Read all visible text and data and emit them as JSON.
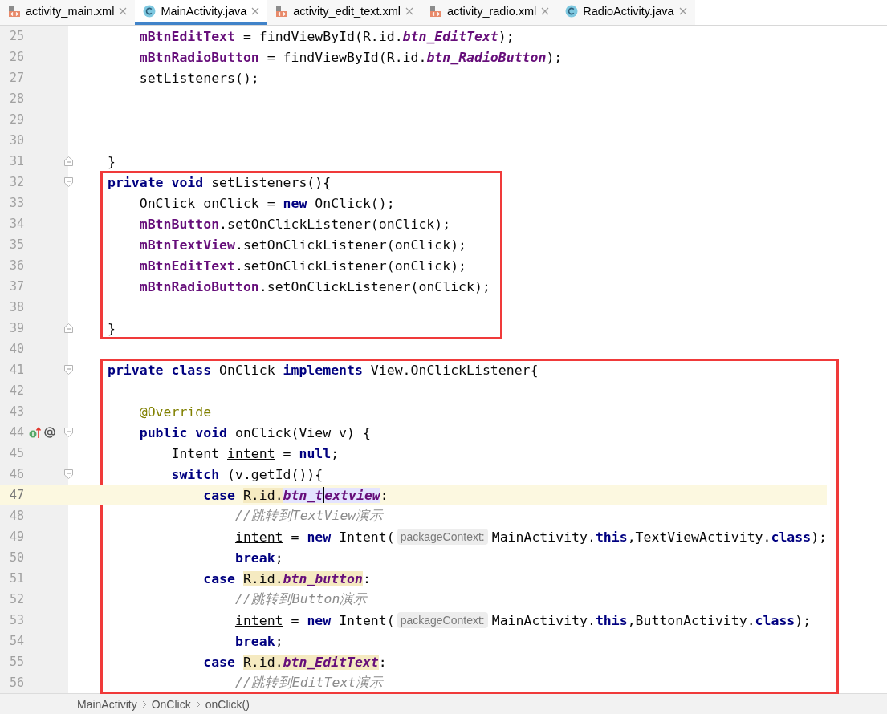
{
  "tabs": [
    {
      "label": "activity_main.xml",
      "kind": "xml",
      "selected": false
    },
    {
      "label": "MainActivity.java",
      "kind": "java",
      "selected": true
    },
    {
      "label": "activity_edit_text.xml",
      "kind": "xml",
      "selected": false
    },
    {
      "label": "activity_radio.xml",
      "kind": "xml",
      "selected": false
    },
    {
      "label": "RadioActivity.java",
      "kind": "java",
      "selected": false
    }
  ],
  "editor": {
    "blocks": [
      {
        "boxed": false,
        "lines": [
          {
            "number": "25",
            "current": false,
            "fold_start": false,
            "fold_end": false,
            "tokens": [
              {
                "kind": "field",
                "text": "    mBtnEditText"
              },
              {
                "kind": "plain",
                "text": " = findViewById(R.id."
              },
              {
                "kind": "static",
                "text": "btn_EditText"
              },
              {
                "kind": "plain",
                "text": ");"
              }
            ]
          },
          {
            "number": "26",
            "current": false,
            "fold_start": false,
            "fold_end": false,
            "tokens": [
              {
                "kind": "field",
                "text": "    mBtnRadioButton"
              },
              {
                "kind": "plain",
                "text": " = findViewById(R.id."
              },
              {
                "kind": "static",
                "text": "btn_RadioButton"
              },
              {
                "kind": "plain",
                "text": ");"
              }
            ]
          },
          {
            "number": "27",
            "current": false,
            "fold_start": false,
            "fold_end": false,
            "tokens": [
              {
                "kind": "plain",
                "text": "    setListeners();"
              }
            ]
          },
          {
            "number": "28",
            "current": false,
            "fold_start": false,
            "fold_end": false
          },
          {
            "number": "29",
            "current": false,
            "fold_start": false,
            "fold_end": false
          },
          {
            "number": "30",
            "current": false,
            "fold_start": false,
            "fold_end": false
          },
          {
            "number": "31",
            "current": false,
            "fold_start": false,
            "fold_end": true,
            "tokens": [
              {
                "kind": "plain",
                "text": "}"
              }
            ]
          }
        ]
      },
      {
        "boxed": true,
        "lines": [
          {
            "number": "32",
            "current": false,
            "fold_start": true,
            "fold_end": false,
            "tokens": [
              {
                "kind": "keyword",
                "text": "private void"
              },
              {
                "kind": "plain",
                "text": " setListeners(){"
              }
            ]
          },
          {
            "number": "33",
            "current": false,
            "fold_start": false,
            "fold_end": false,
            "tokens": [
              {
                "kind": "plain",
                "text": "    OnClick onClick = "
              },
              {
                "kind": "keyword",
                "text": "new"
              },
              {
                "kind": "plain",
                "text": " OnClick();"
              }
            ]
          },
          {
            "number": "34",
            "current": false,
            "fold_start": false,
            "fold_end": false,
            "tokens": [
              {
                "kind": "field",
                "text": "    mBtnButton"
              },
              {
                "kind": "plain",
                "text": ".setOnClickListener(onClick);"
              }
            ]
          },
          {
            "number": "35",
            "current": false,
            "fold_start": false,
            "fold_end": false,
            "tokens": [
              {
                "kind": "field",
                "text": "    mBtnTextView"
              },
              {
                "kind": "plain",
                "text": ".setOnClickListener(onClick);"
              }
            ]
          },
          {
            "number": "36",
            "current": false,
            "fold_start": false,
            "fold_end": false,
            "tokens": [
              {
                "kind": "field",
                "text": "    mBtnEditText"
              },
              {
                "kind": "plain",
                "text": ".setOnClickListener(onClick);"
              }
            ]
          },
          {
            "number": "37",
            "current": false,
            "fold_start": false,
            "fold_end": false,
            "tokens": [
              {
                "kind": "field",
                "text": "    mBtnRadioButton"
              },
              {
                "kind": "plain",
                "text": ".setOnClickListener(onClick);"
              }
            ]
          },
          {
            "number": "38",
            "current": false,
            "fold_start": false,
            "fold_end": false
          },
          {
            "number": "39",
            "current": false,
            "fold_start": false,
            "fold_end": true,
            "tokens": [
              {
                "kind": "plain",
                "text": "}"
              }
            ]
          }
        ]
      },
      {
        "boxed": false,
        "lines": [
          {
            "number": "40",
            "current": false,
            "fold_start": false,
            "fold_end": false
          }
        ]
      },
      {
        "boxed": true,
        "lines": [
          {
            "number": "41",
            "current": false,
            "fold_start": true,
            "fold_end": false,
            "tokens": [
              {
                "kind": "keyword",
                "text": "private class"
              },
              {
                "kind": "plain",
                "text": " OnClick "
              },
              {
                "kind": "keyword",
                "text": "implements"
              },
              {
                "kind": "plain",
                "text": " View.OnClickListener{"
              }
            ]
          },
          {
            "number": "42",
            "current": false,
            "fold_start": false,
            "fold_end": false
          },
          {
            "number": "43",
            "current": false,
            "fold_start": false,
            "fold_end": false,
            "tokens": [
              {
                "kind": "annotation",
                "text": "    @Override"
              }
            ]
          },
          {
            "number": "44",
            "current": false,
            "fold_start": true,
            "fold_end": false,
            "gutter_icons": [
              {
                "kind": "implements"
              },
              {
                "kind": "override"
              }
            ],
            "tokens": [
              {
                "kind": "keyword",
                "text": "    public void"
              },
              {
                "kind": "plain",
                "text": " onClick(View v) {"
              }
            ]
          },
          {
            "number": "45",
            "current": false,
            "fold_start": false,
            "fold_end": false,
            "tokens": [
              {
                "kind": "plain",
                "text": "        Intent "
              },
              {
                "kind": "reassigned",
                "text": "intent"
              },
              {
                "kind": "plain",
                "text": " = "
              },
              {
                "kind": "keyword",
                "text": "null"
              },
              {
                "kind": "plain",
                "text": ";"
              }
            ]
          },
          {
            "number": "46",
            "current": false,
            "fold_start": true,
            "fold_end": false,
            "tokens": [
              {
                "kind": "keyword",
                "text": "        switch"
              },
              {
                "kind": "plain",
                "text": " (v.getId()){"
              }
            ]
          },
          {
            "number": "47",
            "current": true,
            "fold_start": false,
            "fold_end": false,
            "tokens": [
              {
                "kind": "keyword",
                "text": "            case"
              },
              {
                "kind": "ref-usage",
                "text": " R.id."
              },
              {
                "kind": "static-selected",
                "text": "btn_t"
              },
              {
                "kind": "caret"
              },
              {
                "kind": "static-selected",
                "text": "extview"
              },
              {
                "kind": "plain",
                "text": ":"
              }
            ]
          },
          {
            "number": "48",
            "current": false,
            "fold_start": false,
            "fold_end": false,
            "tokens": [
              {
                "kind": "comment",
                "text": "                //跳转到TextView演示"
              }
            ]
          },
          {
            "number": "49",
            "current": false,
            "fold_start": false,
            "fold_end": false,
            "tokens": [
              {
                "kind": "reassigned",
                "text": "                intent"
              },
              {
                "kind": "plain",
                "text": " = "
              },
              {
                "kind": "keyword",
                "text": "new"
              },
              {
                "kind": "plain",
                "text": " Intent("
              },
              {
                "kind": "hint",
                "text": "packageContext:"
              },
              {
                "kind": "plain",
                "text": "MainActivity."
              },
              {
                "kind": "keyword",
                "text": "this"
              },
              {
                "kind": "plain",
                "text": ",TextViewActivity."
              },
              {
                "kind": "keyword",
                "text": "class"
              },
              {
                "kind": "plain",
                "text": ");"
              }
            ]
          },
          {
            "number": "50",
            "current": false,
            "fold_start": false,
            "fold_end": false,
            "tokens": [
              {
                "kind": "keyword",
                "text": "                break"
              },
              {
                "kind": "plain",
                "text": ";"
              }
            ]
          },
          {
            "number": "51",
            "current": false,
            "fold_start": false,
            "fold_end": false,
            "tokens": [
              {
                "kind": "keyword",
                "text": "            case"
              },
              {
                "kind": "ref-usage",
                "text": " R.id."
              },
              {
                "kind": "static-usage",
                "text": "btn_button"
              },
              {
                "kind": "plain",
                "text": ":"
              }
            ]
          },
          {
            "number": "52",
            "current": false,
            "fold_start": false,
            "fold_end": false,
            "tokens": [
              {
                "kind": "comment",
                "text": "                //跳转到Button演示"
              }
            ]
          },
          {
            "number": "53",
            "current": false,
            "fold_start": false,
            "fold_end": false,
            "tokens": [
              {
                "kind": "reassigned",
                "text": "                intent"
              },
              {
                "kind": "plain",
                "text": " = "
              },
              {
                "kind": "keyword",
                "text": "new"
              },
              {
                "kind": "plain",
                "text": " Intent("
              },
              {
                "kind": "hint",
                "text": "packageContext:"
              },
              {
                "kind": "plain",
                "text": "MainActivity."
              },
              {
                "kind": "keyword",
                "text": "this"
              },
              {
                "kind": "plain",
                "text": ",ButtonActivity."
              },
              {
                "kind": "keyword",
                "text": "class"
              },
              {
                "kind": "plain",
                "text": ");"
              }
            ]
          },
          {
            "number": "54",
            "current": false,
            "fold_start": false,
            "fold_end": false,
            "tokens": [
              {
                "kind": "keyword",
                "text": "                break"
              },
              {
                "kind": "plain",
                "text": ";"
              }
            ]
          },
          {
            "number": "55",
            "current": false,
            "fold_start": false,
            "fold_end": false,
            "tokens": [
              {
                "kind": "keyword",
                "text": "            case"
              },
              {
                "kind": "ref-usage",
                "text": " R.id."
              },
              {
                "kind": "static-usage",
                "text": "btn_EditText"
              },
              {
                "kind": "plain",
                "text": ":"
              }
            ]
          },
          {
            "number": "56",
            "current": false,
            "fold_start": false,
            "fold_end": false,
            "tokens": [
              {
                "kind": "comment",
                "text": "                //跳转到EditText演示"
              }
            ]
          }
        ]
      }
    ]
  },
  "breadcrumb": [
    "MainActivity",
    "OnClick",
    "onClick()"
  ]
}
